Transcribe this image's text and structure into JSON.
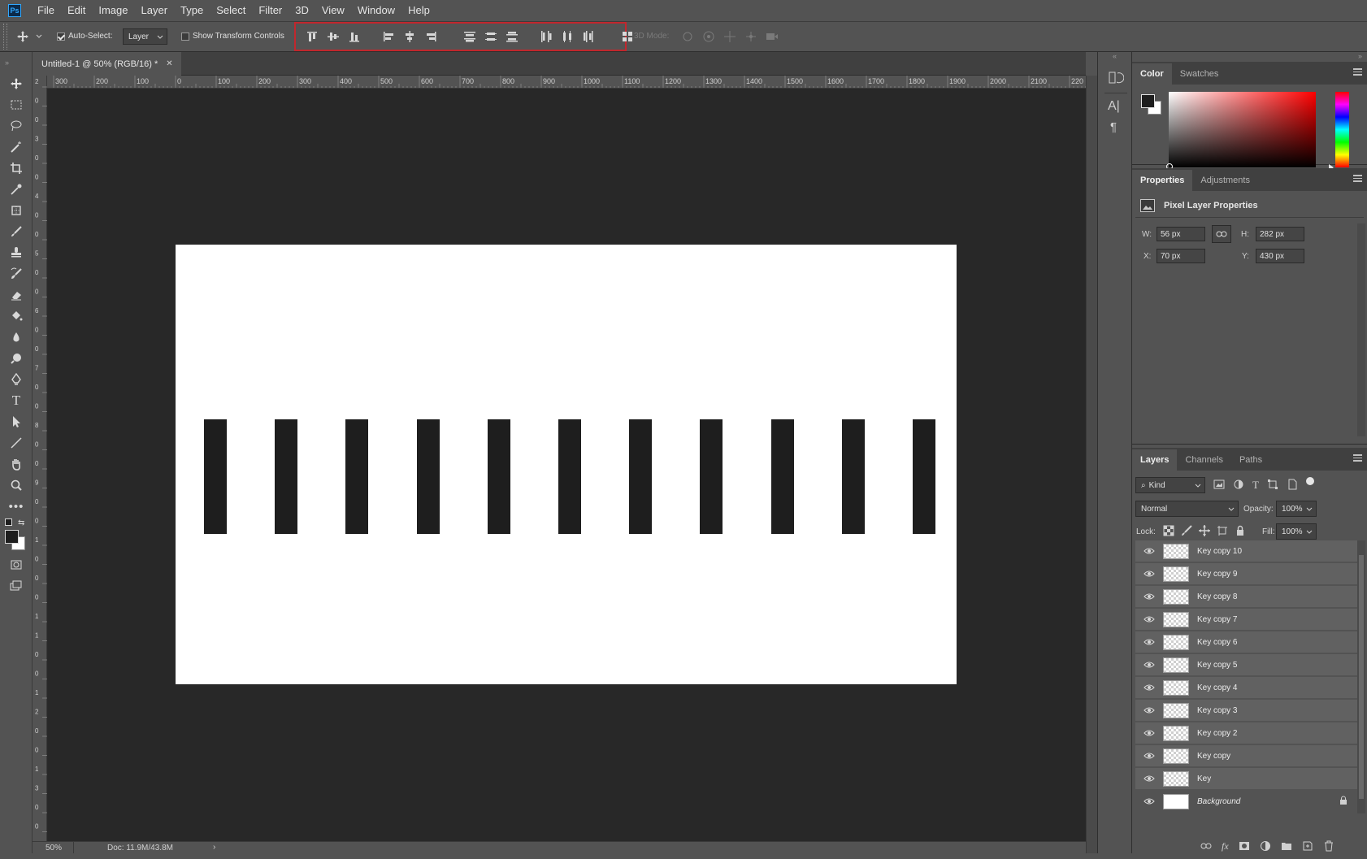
{
  "menubar": {
    "app_icon": "Ps",
    "items": [
      "File",
      "Edit",
      "Image",
      "Layer",
      "Type",
      "Select",
      "Filter",
      "3D",
      "View",
      "Window",
      "Help"
    ]
  },
  "options": {
    "auto_select_label": "Auto-Select:",
    "auto_select_checked": true,
    "target_value": "Layer",
    "show_transform_label": "Show Transform Controls",
    "show_transform_checked": false,
    "mode_label": "3D Mode:",
    "align_icons": [
      "align-top-edges-icon",
      "align-vertical-centers-icon",
      "align-bottom-edges-icon",
      "align-left-edges-icon",
      "align-horizontal-centers-icon",
      "align-right-edges-icon"
    ],
    "distribute_icons": [
      "distribute-top-edges-icon",
      "distribute-vertical-centers-icon",
      "distribute-bottom-edges-icon",
      "distribute-left-edges-icon",
      "distribute-horizontal-centers-icon",
      "distribute-right-edges-icon"
    ],
    "auto_align_icon": "auto-align-layers-icon",
    "highlight_color": "#c1272d"
  },
  "document": {
    "tab_title": "Untitled-1 @ 50% (RGB/16) *",
    "zoom": "50%",
    "doc_size": "Doc: 11.9M/43.8M",
    "background": "#282828",
    "artboard_color": "#ffffff",
    "key_color": "#1e1e1e",
    "key_count": 11
  },
  "ruler": {
    "h_labels": [
      "300",
      "200",
      "100",
      "0",
      "100",
      "200",
      "300",
      "400",
      "500",
      "600",
      "700",
      "800",
      "900",
      "1000",
      "1100",
      "1200",
      "1300",
      "1400",
      "1500",
      "1600",
      "1700",
      "1800",
      "1900",
      "2000",
      "2100",
      "220"
    ],
    "v_labels": [
      "2",
      "0",
      "0",
      "3",
      "0",
      "0",
      "4",
      "0",
      "0",
      "5",
      "0",
      "0",
      "6",
      "0",
      "0",
      "7",
      "0",
      "0",
      "8",
      "0",
      "0",
      "9",
      "0",
      "0",
      "1",
      "0",
      "0",
      "0",
      "1",
      "1",
      "0",
      "0",
      "1",
      "2",
      "0",
      "0",
      "1",
      "3",
      "0",
      "0"
    ]
  },
  "tools": [
    "move-tool-icon",
    "marquee-tool-icon",
    "lasso-tool-icon",
    "magic-wand-tool-icon",
    "crop-tool-icon",
    "eyedropper-tool-icon",
    "frame-tool-icon",
    "brush-tool-icon",
    "stamp-tool-icon",
    "history-brush-icon",
    "eraser-tool-icon",
    "paint-bucket-icon",
    "blur-tool-icon",
    "dodge-tool-icon",
    "pen-tool-icon",
    "type-tool-icon",
    "path-selection-icon",
    "line-tool-icon",
    "hand-tool-icon",
    "zoom-tool-icon",
    "more-tools-icon"
  ],
  "color_panel": {
    "tabs": [
      "Color",
      "Swatches"
    ],
    "foreground": "#1e1e1e",
    "background": "#ffffff",
    "field_hue": "#ff0000"
  },
  "properties_panel": {
    "tabs": [
      "Properties",
      "Adjustments"
    ],
    "header": "Pixel Layer Properties",
    "w_label": "W:",
    "w_value": "56 px",
    "h_label": "H:",
    "h_value": "282 px",
    "x_label": "X:",
    "x_value": "70 px",
    "y_label": "Y:",
    "y_value": "430 px"
  },
  "layers_panel": {
    "tabs": [
      "Layers",
      "Channels",
      "Paths"
    ],
    "kind": "Kind",
    "blend_mode": "Normal",
    "opacity_label": "Opacity:",
    "opacity_value": "100%",
    "lock_label": "Lock:",
    "fill_label": "Fill:",
    "fill_value": "100%",
    "layers": [
      "Key copy 10",
      "Key copy 9",
      "Key copy 8",
      "Key copy 7",
      "Key copy 6",
      "Key copy 5",
      "Key copy 4",
      "Key copy 3",
      "Key copy 2",
      "Key copy",
      "Key",
      "Background"
    ]
  }
}
